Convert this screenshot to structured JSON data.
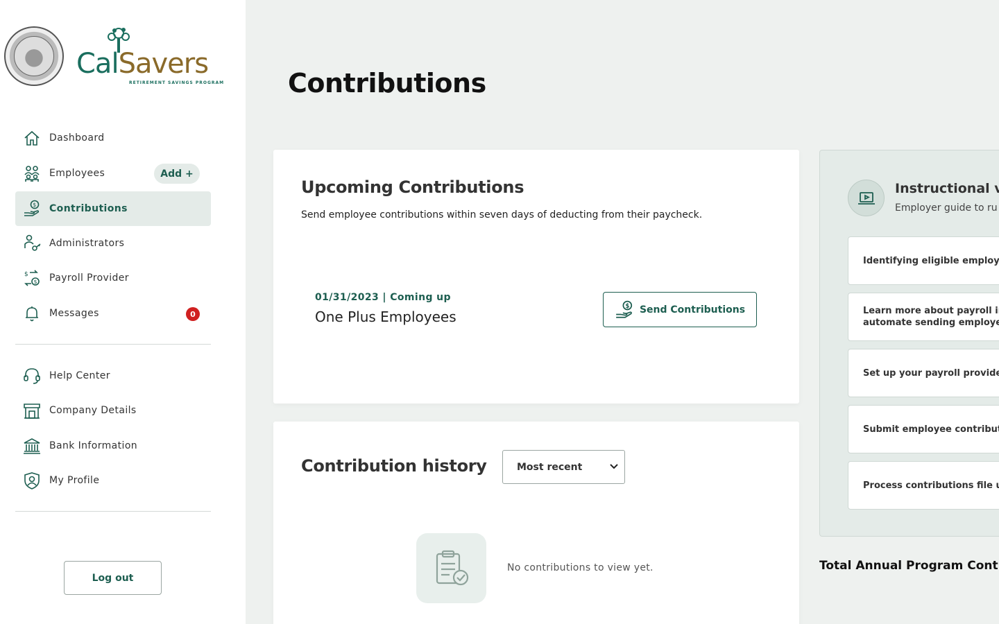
{
  "brand": {
    "name_part1": "Cal",
    "name_part2": "Savers",
    "tagline": "RETIREMENT SAVINGS PROGRAM"
  },
  "nav": {
    "items": [
      {
        "label": "Dashboard",
        "icon": "home-icon"
      },
      {
        "label": "Employees",
        "icon": "people-icon",
        "action": "Add +"
      },
      {
        "label": "Contributions",
        "icon": "hand-dollar-icon",
        "active": true
      },
      {
        "label": "Administrators",
        "icon": "admin-key-icon"
      },
      {
        "label": "Payroll Provider",
        "icon": "payroll-exchange-icon"
      },
      {
        "label": "Messages",
        "icon": "bell-icon",
        "badge": "0"
      }
    ],
    "secondary": [
      {
        "label": "Help Center",
        "icon": "headset-icon"
      },
      {
        "label": "Company Details",
        "icon": "storefront-icon"
      },
      {
        "label": "Bank Information",
        "icon": "bank-icon"
      },
      {
        "label": "My Profile",
        "icon": "profile-shield-icon"
      }
    ],
    "logout_label": "Log out"
  },
  "page": {
    "title": "Contributions"
  },
  "upcoming": {
    "title": "Upcoming Contributions",
    "description": "Send employee contributions within seven days of deducting from their paycheck.",
    "date_status": "01/31/2023 | Coming up",
    "payroll_name": "One Plus Employees",
    "send_label": "Send Contributions"
  },
  "history": {
    "title": "Contribution history",
    "sort_selected": "Most recent",
    "empty_text": "No contributions to view yet."
  },
  "instructional": {
    "title": "Instructional vi",
    "subtitle": "Employer guide to ru",
    "videos": [
      "Identifying eligible employe",
      "Learn more about payroll in",
      "automate sending employe",
      "Set up your payroll provider",
      "Submit employee contribut",
      "Process contributions file u"
    ]
  },
  "total": {
    "title": "Total Annual Program Cont"
  },
  "colors": {
    "accent": "#1d5e50",
    "badge": "#d02020",
    "brand_gold": "#8a6a2a"
  }
}
